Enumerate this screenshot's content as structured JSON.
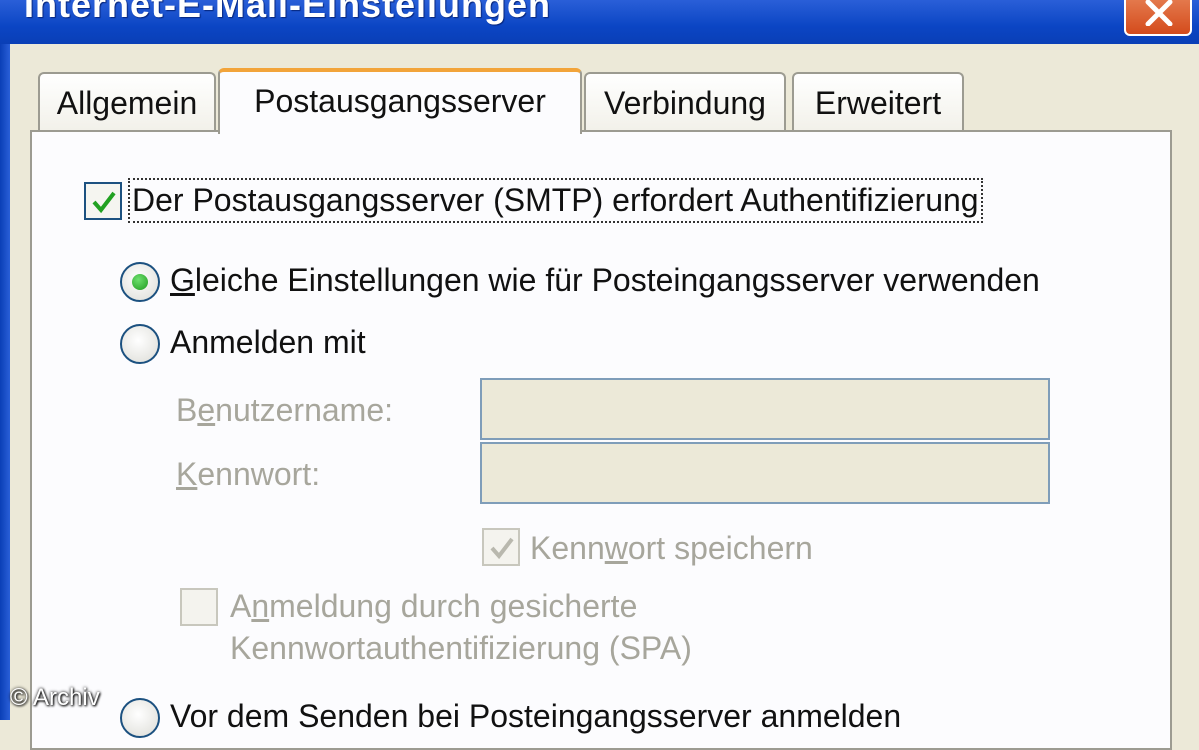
{
  "window": {
    "title": "Internet-E-Mail-Einstellungen",
    "close_icon": "close-icon"
  },
  "tabs": [
    {
      "label": "Allgemein",
      "active": false
    },
    {
      "label": "Postausgangsserver",
      "active": true
    },
    {
      "label": "Verbindung",
      "active": false
    },
    {
      "label": "Erweitert",
      "active": false
    }
  ],
  "smtp_auth": {
    "label": "Der Postausgangsserver (SMTP) erfordert Authentifizierung",
    "checked": true
  },
  "options": {
    "same_settings": {
      "label_accel": "G",
      "label_rest": "leiche Einstellungen wie für Posteingangsserver verwenden",
      "selected": true
    },
    "login_with": {
      "label": "Anmelden mit",
      "selected": false
    },
    "login_before_send": {
      "label": "Vor dem Senden bei Posteingangsserver anmelden",
      "selected": false
    }
  },
  "credentials": {
    "username_label_pre": "B",
    "username_label_accel": "e",
    "username_label_post": "nutzername:",
    "username_value": "",
    "password_label_accel": "K",
    "password_label_post": "ennwort:",
    "password_value": "",
    "save_password_pre": "Kenn",
    "save_password_accel": "w",
    "save_password_post": "ort speichern",
    "save_password_checked": true,
    "spa_line1_pre": "A",
    "spa_line1_accel": "n",
    "spa_line1_post": "meldung durch gesicherte",
    "spa_line2": "Kennwortauthentifizierung (SPA)",
    "spa_checked": false
  },
  "watermark": "© Archiv",
  "colors": {
    "titlebar": "#0b45c4",
    "active_tab_accent": "#f2a43a",
    "check_green": "#21a121",
    "disabled_text": "#a7a69c"
  }
}
